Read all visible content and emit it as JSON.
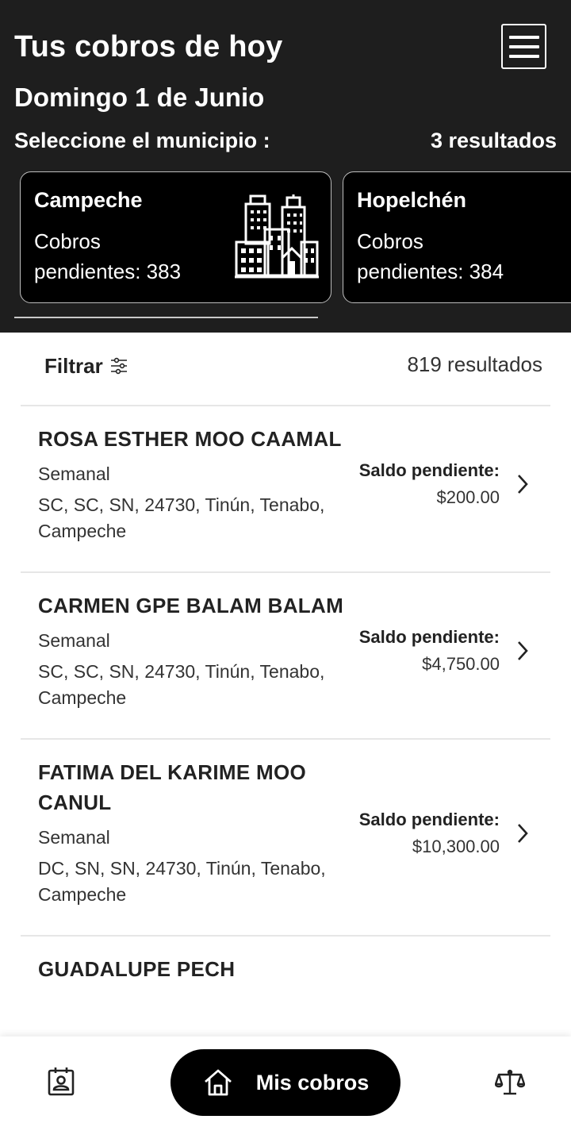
{
  "header": {
    "title": "Tus cobros de hoy",
    "date": "Domingo 1 de Junio",
    "municipality_prompt": "Seleccione el municipio :",
    "municipality_count": "3 resultados"
  },
  "municipalities": [
    {
      "name": "Campeche",
      "label": "Cobros",
      "value": "pendientes: 383",
      "icon": "city-buildings-icon"
    },
    {
      "name": "Hopelchén",
      "label": "Cobros",
      "value": "pendientes: 384"
    }
  ],
  "filter": {
    "label": "Filtrar",
    "results": "819 resultados"
  },
  "clients": [
    {
      "name": "ROSA ESTHER MOO CAAMAL",
      "frequency": "Semanal",
      "address": "SC, SC, SN, 24730, Tinún, Tenabo, Campeche",
      "saldo_label": "Saldo pendiente:",
      "saldo": "$200.00"
    },
    {
      "name": "CARMEN GPE BALAM BALAM",
      "frequency": "Semanal",
      "address": "SC, SC, SN, 24730, Tinún, Tenabo, Campeche",
      "saldo_label": "Saldo pendiente:",
      "saldo": "$4,750.00"
    },
    {
      "name": "FATIMA DEL KARIME MOO CANUL",
      "frequency": "Semanal",
      "address": "DC, SN, SN, 24730, Tinún, Tenabo, Campeche",
      "saldo_label": "Saldo pendiente:",
      "saldo": "$10,300.00"
    },
    {
      "name": "GUADALUPE PECH"
    }
  ],
  "nav": {
    "center_label": "Mis cobros",
    "left_icon": "contact-badge-icon",
    "center_icon": "home-icon",
    "right_icon": "scale-icon"
  },
  "colors": {
    "header_bg": "#1e1e1e",
    "card_bg": "#000000",
    "accent": "#000000"
  }
}
